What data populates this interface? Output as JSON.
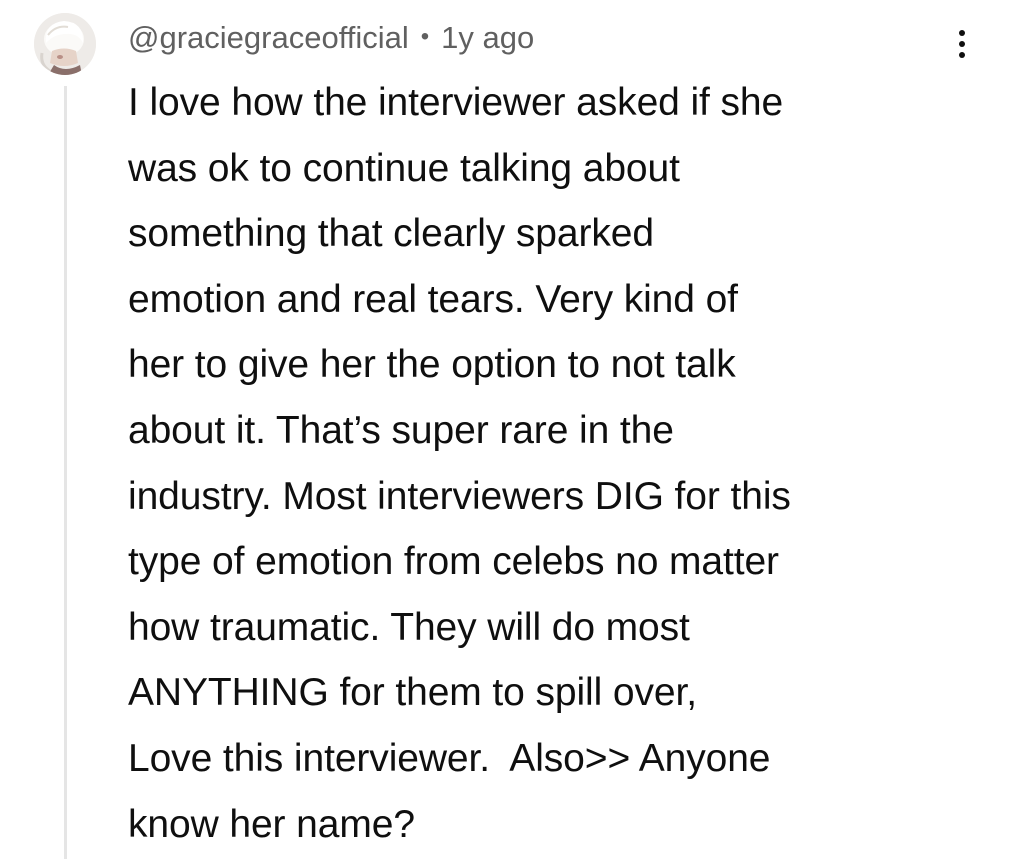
{
  "comment": {
    "author": "@graciegraceofficial",
    "separator": "•",
    "timestamp": "1y ago",
    "avatar_icon": "user-avatar-icon",
    "menu_icon": "more-vertical-icon",
    "lines": [
      "I love how the interviewer asked if she",
      "was ok to continue talking about",
      "something that clearly sparked",
      "emotion and real tears. Very kind of",
      "her to give her the option to not talk",
      "about it. That’s super rare in the",
      "industry. Most interviewers DIG for this",
      "type of emotion from celebs no matter",
      "how traumatic. They will do most",
      "ANYTHING for them to spill over,",
      "Love this interviewer.  Also>> Anyone",
      "know her name?"
    ]
  },
  "colors": {
    "text": "#0f0f0f",
    "meta": "#606060",
    "thread_line": "#e5e5e5",
    "background": "#ffffff"
  }
}
